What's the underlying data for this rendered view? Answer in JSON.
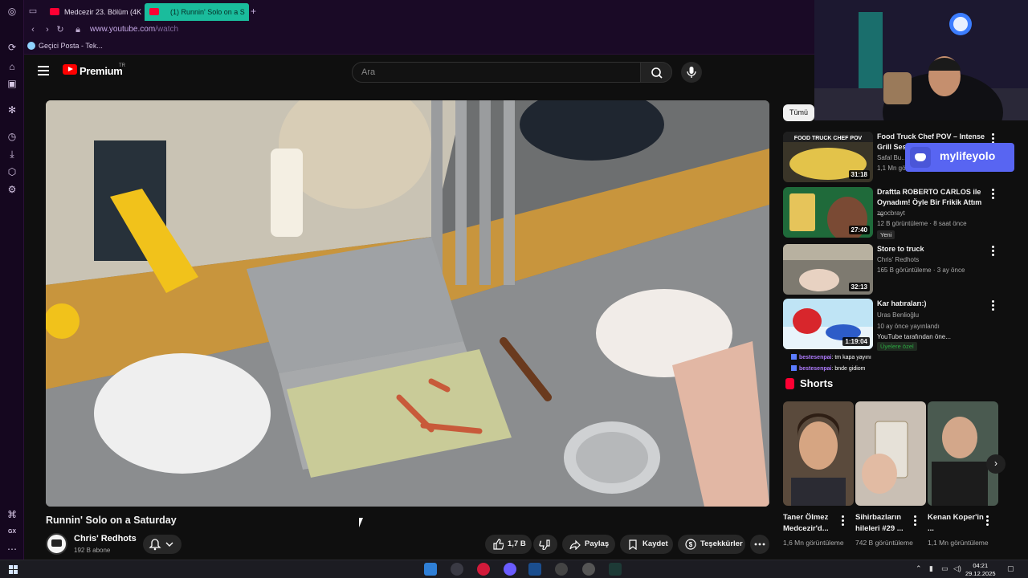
{
  "browser": {
    "tabs": [
      {
        "label": "Medcezir 23. Bölüm (4K)",
        "active": false
      },
      {
        "label": "(1) Runnin' Solo on a S",
        "active": true
      }
    ],
    "url_host": "www.youtube.com",
    "url_path": "/watch",
    "bookmark": "Geçici Posta - Tek..."
  },
  "youtube": {
    "brand": "Premium",
    "country": "TR",
    "search_placeholder": "Ara"
  },
  "video": {
    "title": "Runnin' Solo on a Saturday",
    "channel": "Chris' Redhots",
    "subscribers": "192 B abone",
    "likes": "1,7 B",
    "share_label": "Paylaş",
    "save_label": "Kaydet",
    "thanks_label": "Teşekkürler"
  },
  "sidebar": {
    "chip": "Tümü",
    "recommendations": [
      {
        "title": "Food Truck Chef POV – Intense Grill Ses...",
        "channel": "Safal Bu...",
        "meta": "1,1 Mn gö...",
        "duration": "31:18",
        "thumb_text": "FOOD TRUCK CHEF POV"
      },
      {
        "title": "Draftta ROBERTO CARLOS ile Oynadım! Öyle Bir Frikik Attım ...",
        "channel": "zgocbrayt",
        "meta": "12 B görüntüleme · 8 saat önce",
        "badge": "Yeni",
        "duration": "27:40"
      },
      {
        "title": "Store to truck",
        "channel": "Chris' Redhots",
        "meta": "165 B görüntüleme · 3 ay önce",
        "duration": "32:13"
      },
      {
        "title": "Kar hatıraları:)",
        "channel": "Uras Benlioğlu",
        "meta": "10 ay önce yayınlandı",
        "meta2": "YouTube tarafından öne...",
        "members": "Üyelere özel",
        "duration": "1:19:04"
      }
    ],
    "chat": [
      {
        "user": "bestesenpai",
        "text": ": tm kapa yayını"
      },
      {
        "user": "bestesenpai",
        "text": ": bnde gidiom"
      }
    ],
    "shorts_heading": "Shorts",
    "shorts": [
      {
        "title": "Taner Ölmez Medcezir'd...",
        "views": "1,6 Mn görüntüleme"
      },
      {
        "title": "Sihirbazların hileleri #29 ...",
        "views": "742 B görüntüleme"
      },
      {
        "title": "Kenan Koper'in ...",
        "views": "1,1 Mn görüntüleme"
      }
    ]
  },
  "overlay": {
    "discord_name": "mylifeyolo"
  },
  "taskbar": {
    "time": "04:21",
    "date": "29.12.2025"
  }
}
